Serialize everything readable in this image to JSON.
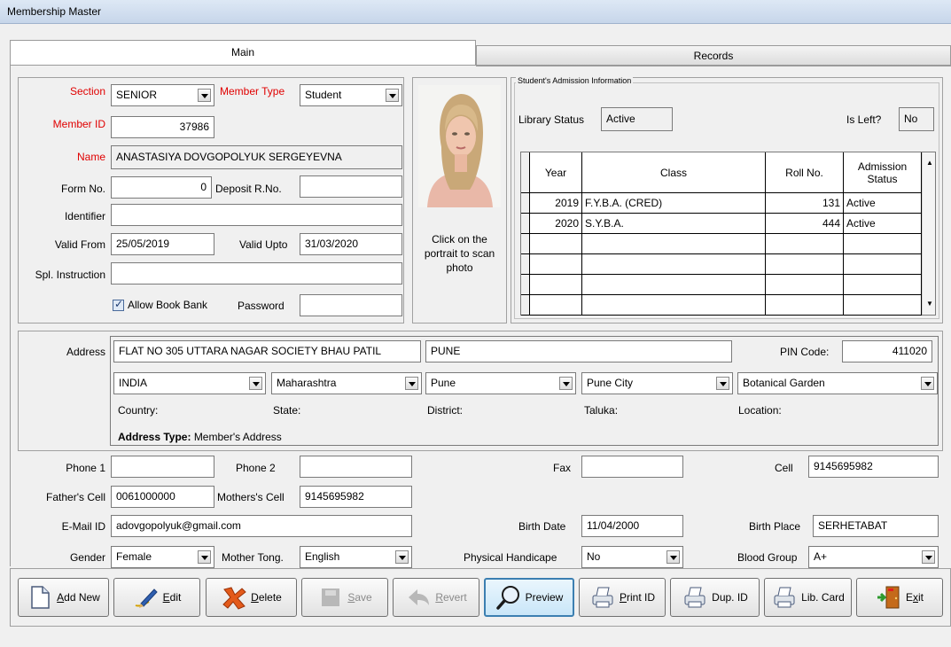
{
  "window": {
    "title": "Membership Master"
  },
  "tabs": [
    {
      "label": "Main"
    },
    {
      "label": "Records"
    }
  ],
  "member": {
    "section_label": "Section",
    "section_value": "SENIOR",
    "member_type_label": "Member Type",
    "member_type_value": "Student",
    "member_id_label": "Member ID",
    "member_id_value": "37986",
    "name_label": "Name",
    "name_value": "ANASTASIYA DOVGOPOLYUK SERGEYEVNA",
    "form_no_label": "Form No.",
    "form_no_value": "0",
    "deposit_label": "Deposit R.No.",
    "deposit_value": "",
    "identifier_label": "Identifier",
    "identifier_value": "",
    "valid_from_label": "Valid From",
    "valid_from_value": "25/05/2019",
    "valid_upto_label": "Valid Upto",
    "valid_upto_value": "31/03/2020",
    "spl_label": "Spl. Instruction",
    "spl_value": "",
    "allow_book_bank_label": "Allow Book Bank",
    "allow_book_bank_checked": true,
    "password_label": "Password",
    "password_value": ""
  },
  "photo": {
    "caption": "Click on the portrait to scan photo"
  },
  "admission": {
    "group_title": "Student's Admission Information",
    "library_status_label": "Library Status",
    "library_status_value": "Active",
    "is_left_label": "Is Left?",
    "is_left_value": "No",
    "columns": [
      "Year",
      "Class",
      "Roll No.",
      "Admission Status"
    ],
    "rows": [
      {
        "year": "2019",
        "class": "F.Y.B.A. (CRED)",
        "roll": "131",
        "status": "Active"
      },
      {
        "year": "2020",
        "class": "S.Y.B.A.",
        "roll": "444",
        "status": "Active"
      }
    ]
  },
  "address": {
    "label": "Address",
    "line1": "FLAT NO 305 UTTARA NAGAR SOCIETY BHAU PATIL",
    "city": "PUNE",
    "pin_label": "PIN Code:",
    "pin_value": "411020",
    "country_value": "INDIA",
    "state_value": "Maharashtra",
    "district_value": "Pune",
    "taluka_value": "Pune City",
    "location_value": "Botanical Garden",
    "country_label": "Country:",
    "state_label": "State:",
    "district_label": "District:",
    "taluka_label": "Taluka:",
    "location_label": "Location:",
    "type_label": "Address Type:",
    "type_value": "Member's Address"
  },
  "contact": {
    "phone1_label": "Phone 1",
    "phone1_value": "",
    "phone2_label": "Phone 2",
    "phone2_value": "",
    "fax_label": "Fax",
    "fax_value": "",
    "cell_label": "Cell",
    "cell_value": "9145695982",
    "father_cell_label": "Father's Cell",
    "father_cell_value": "0061000000",
    "mother_cell_label": "Mothers's Cell",
    "mother_cell_value": "9145695982",
    "email_label": "E-Mail ID",
    "email_value": "adovgopolyuk@gmail.com",
    "birth_date_label": "Birth Date",
    "birth_date_value": "11/04/2000",
    "birth_place_label": "Birth Place",
    "birth_place_value": "SERHETABAT",
    "gender_label": "Gender",
    "gender_value": "Female",
    "mother_tong_label": "Mother Tong.",
    "mother_tong_value": "English",
    "handicap_label": "Physical Handicape",
    "handicap_value": "No",
    "blood_group_label": "Blood Group",
    "blood_group_value": "A+"
  },
  "toolbar": {
    "add_new": {
      "u": "A",
      "rest": "dd New"
    },
    "edit": {
      "u": "E",
      "rest": "dit"
    },
    "delete": {
      "u": "D",
      "rest": "elete"
    },
    "save": {
      "u": "S",
      "rest": "ave"
    },
    "revert": {
      "u": "R",
      "rest": "evert"
    },
    "preview": "Preview",
    "print_id": {
      "u": "P",
      "rest": "rint ID"
    },
    "dup_id": "Dup. ID",
    "lib_card": "Lib. Card",
    "exit": {
      "pre": "E",
      "u": "x",
      "rest": "it"
    }
  }
}
